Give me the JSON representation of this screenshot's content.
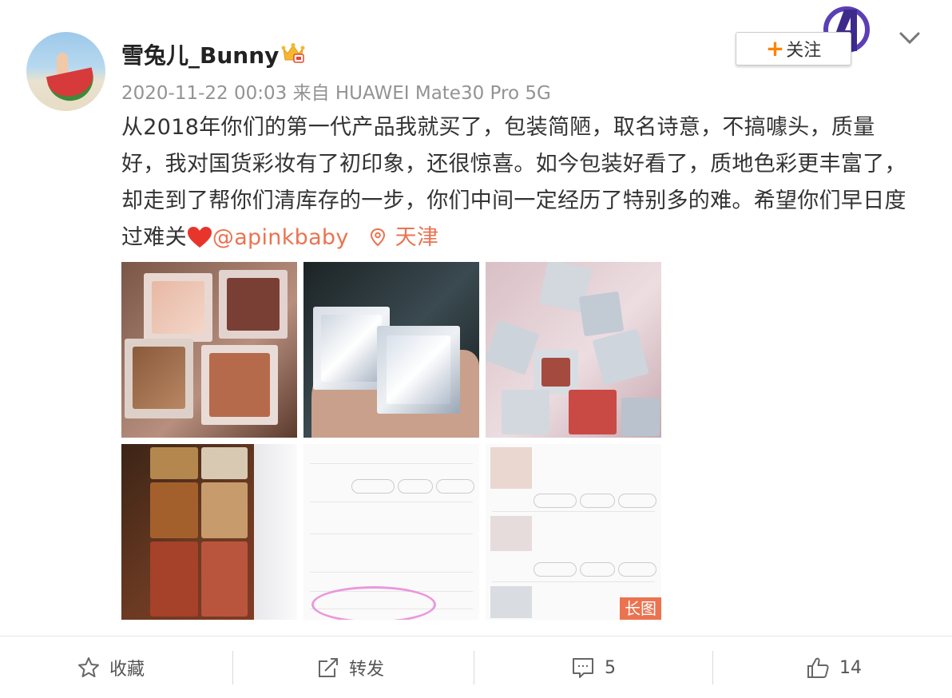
{
  "post": {
    "username": "雪兔儿_Bunny",
    "meta": "2020-11-22 00:03  来自 HUAWEI Mate30 Pro 5G",
    "text": "从2018年你们的第一代产品我就买了，包装简陋，取名诗意，不搞噱头，质量好，我对国货彩妆有了初印象，还很惊喜。如今包装好看了，质地色彩更丰富了，却走到了帮你们清库存的一步，你们中间一定经历了特别多的难。希望你们早日度过难关",
    "mention": "@apinkbaby",
    "location": "天津",
    "follow_label": "关注",
    "long_image_tag": "长图"
  },
  "actions": {
    "favorite": "收藏",
    "repost": "转发",
    "comment_count": "5",
    "like_count": "14"
  },
  "icons": [
    "crown-vip-icon",
    "avengers-badge-icon",
    "chevron-down-icon",
    "heart-emoji-icon",
    "location-pin-icon",
    "star-icon",
    "repost-icon",
    "comment-icon",
    "thumb-up-icon"
  ],
  "colors": {
    "accent": "#eb7350",
    "follow_plus": "#ff8200",
    "text": "#333333",
    "meta": "#939393"
  }
}
